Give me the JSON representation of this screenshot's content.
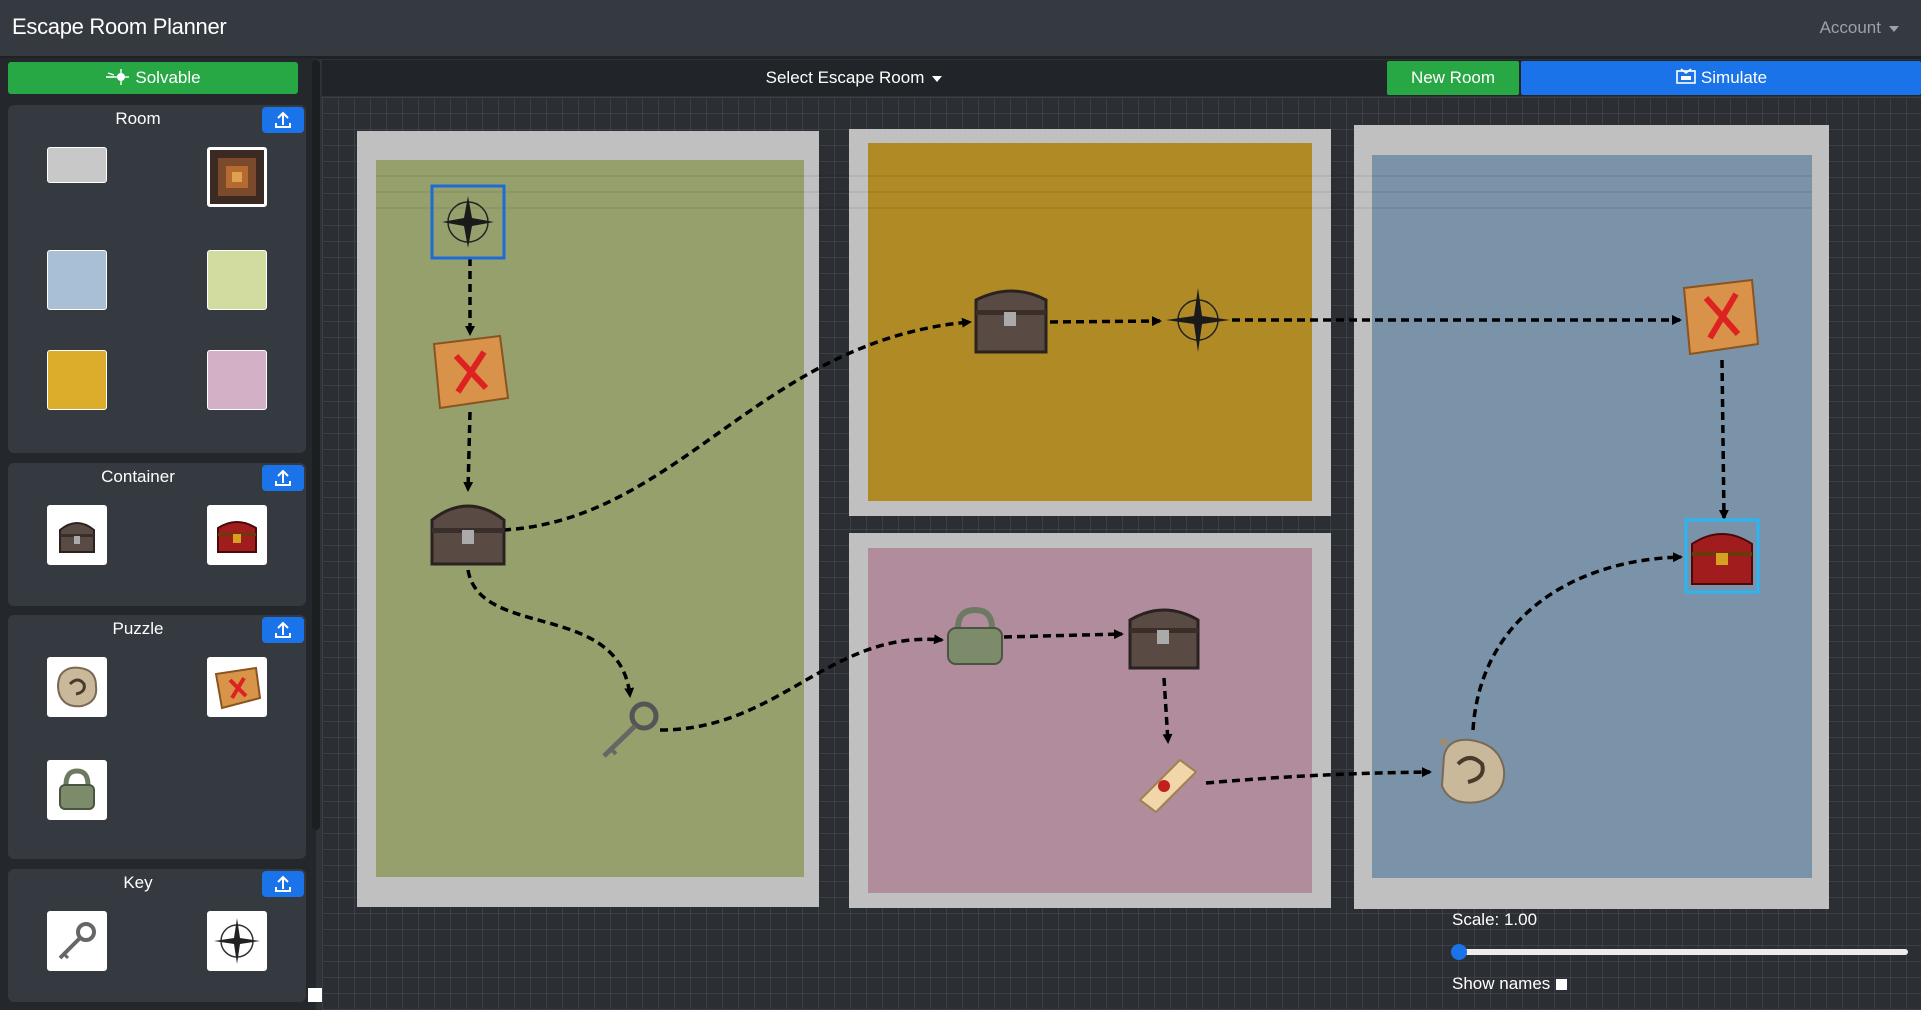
{
  "app": {
    "title": "Escape Room Planner",
    "account_label": "Account"
  },
  "sidebar": {
    "solvable_label": "Solvable",
    "sections": [
      {
        "title": "Room"
      },
      {
        "title": "Container"
      },
      {
        "title": "Puzzle"
      },
      {
        "title": "Key"
      }
    ]
  },
  "toolbar": {
    "select_room_label": "Select Escape Room",
    "new_room_label": "New Room",
    "simulate_label": "Simulate"
  },
  "canvas": {
    "scale_label": "Scale: 1.00",
    "scale_value": 0.0,
    "show_names_label": "Show names",
    "show_names_checked": false,
    "room_colors": [
      "#9aa36f",
      "#b38e26",
      "#b38f9f",
      "#7c95ab"
    ]
  },
  "colors": {
    "accent_green": "#28a745",
    "accent_blue": "#1a73e8",
    "selection_blue": "#1e6bd6",
    "selection_cyan": "#29b6f6"
  }
}
